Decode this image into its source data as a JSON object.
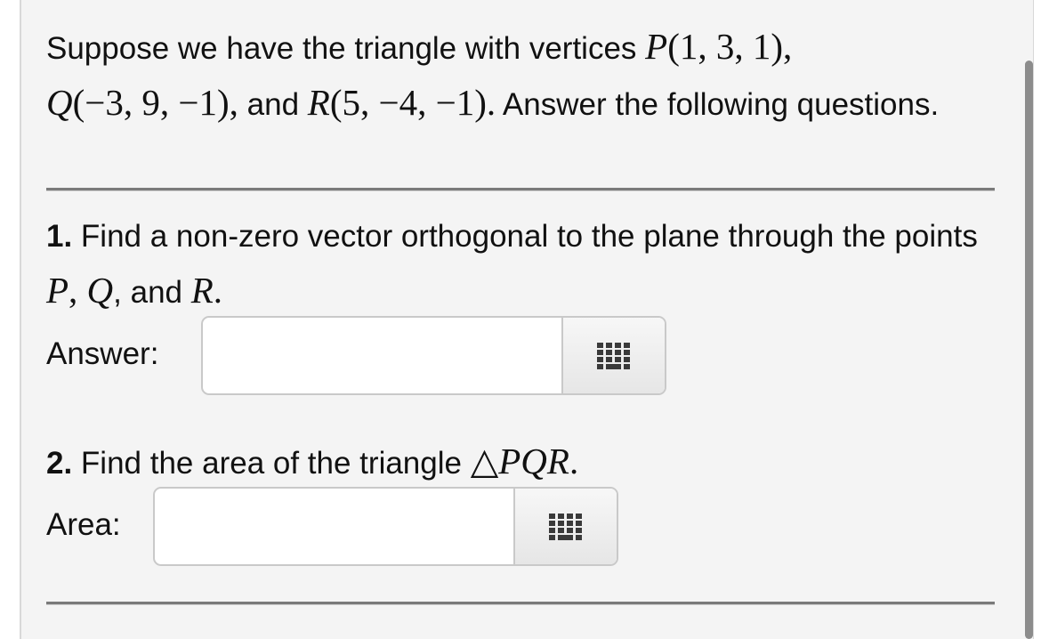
{
  "intro": {
    "line1_text": "Suppose we have the triangle with vertices ",
    "P_label": "P",
    "P_coords": "(1, 3, 1),",
    "Q_label": "Q",
    "Q_coords": "(−3, 9, −1),",
    "and_text": " and ",
    "R_label": "R",
    "R_coords": "(5, −4, −1).",
    "tail_text": " Answer the following questions."
  },
  "q1": {
    "number": "1.",
    "text_a": " Find a non-zero vector orthogonal to the plane through the points ",
    "P": "P",
    "comma1": ", ",
    "Q": "Q",
    "comma2": ", and ",
    "R": "R",
    "period": ".",
    "answer_label": "Answer:",
    "answer_value": "",
    "keypad_icon": "keypad-grid-icon"
  },
  "q2": {
    "number": "2.",
    "text_a": " Find the area of the triangle ",
    "triangle_symbol": "△",
    "triangle_name": "PQR",
    "period": ".",
    "answer_label": "Area:",
    "answer_value": "",
    "keypad_icon": "keypad-grid-icon"
  }
}
